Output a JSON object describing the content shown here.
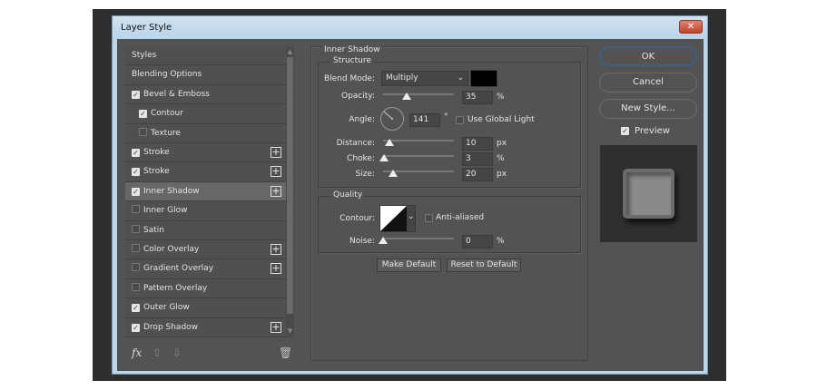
{
  "window": {
    "title": "Layer Style",
    "close": "✕"
  },
  "sidebar": {
    "items": [
      {
        "label": "Styles",
        "checkbox": false,
        "checked": false,
        "plus": false,
        "indent": false,
        "selected": false
      },
      {
        "label": "Blending Options",
        "checkbox": false,
        "checked": false,
        "plus": false,
        "indent": false,
        "selected": false
      },
      {
        "label": "Bevel & Emboss",
        "checkbox": true,
        "checked": true,
        "plus": false,
        "indent": false,
        "selected": false
      },
      {
        "label": "Contour",
        "checkbox": true,
        "checked": true,
        "plus": false,
        "indent": true,
        "selected": false
      },
      {
        "label": "Texture",
        "checkbox": true,
        "checked": false,
        "plus": false,
        "indent": true,
        "selected": false
      },
      {
        "label": "Stroke",
        "checkbox": true,
        "checked": true,
        "plus": true,
        "indent": false,
        "selected": false
      },
      {
        "label": "Stroke",
        "checkbox": true,
        "checked": true,
        "plus": true,
        "indent": false,
        "selected": false
      },
      {
        "label": "Inner Shadow",
        "checkbox": true,
        "checked": true,
        "plus": true,
        "indent": false,
        "selected": true
      },
      {
        "label": "Inner Glow",
        "checkbox": true,
        "checked": false,
        "plus": false,
        "indent": false,
        "selected": false
      },
      {
        "label": "Satin",
        "checkbox": true,
        "checked": false,
        "plus": false,
        "indent": false,
        "selected": false
      },
      {
        "label": "Color Overlay",
        "checkbox": true,
        "checked": false,
        "plus": true,
        "indent": false,
        "selected": false
      },
      {
        "label": "Gradient Overlay",
        "checkbox": true,
        "checked": false,
        "plus": true,
        "indent": false,
        "selected": false
      },
      {
        "label": "Pattern Overlay",
        "checkbox": true,
        "checked": false,
        "plus": false,
        "indent": false,
        "selected": false
      },
      {
        "label": "Outer Glow",
        "checkbox": true,
        "checked": true,
        "plus": false,
        "indent": false,
        "selected": false
      },
      {
        "label": "Drop Shadow",
        "checkbox": true,
        "checked": true,
        "plus": true,
        "indent": false,
        "selected": false
      }
    ],
    "fx_label": "fx"
  },
  "panel": {
    "title": "Inner Shadow",
    "structure": {
      "title": "Structure",
      "blend_mode_label": "Blend Mode:",
      "blend_mode": "Multiply",
      "shadow_color": "#000000",
      "opacity_label": "Opacity:",
      "opacity": "35",
      "opacity_unit": "%",
      "angle_label": "Angle:",
      "angle": "141",
      "angle_unit": "°",
      "global_light_label": "Use Global Light",
      "global_light": false,
      "distance_label": "Distance:",
      "distance": "10",
      "distance_unit": "px",
      "choke_label": "Choke:",
      "choke": "3",
      "choke_unit": "%",
      "size_label": "Size:",
      "size": "20",
      "size_unit": "px"
    },
    "quality": {
      "title": "Quality",
      "contour_label": "Contour:",
      "anti_aliased_label": "Anti-aliased",
      "anti_aliased": false,
      "noise_label": "Noise:",
      "noise": "0",
      "noise_unit": "%"
    },
    "make_default": "Make Default",
    "reset_default": "Reset to Default"
  },
  "actions": {
    "ok": "OK",
    "cancel": "Cancel",
    "new_style": "New Style...",
    "preview_label": "Preview",
    "preview": true
  }
}
